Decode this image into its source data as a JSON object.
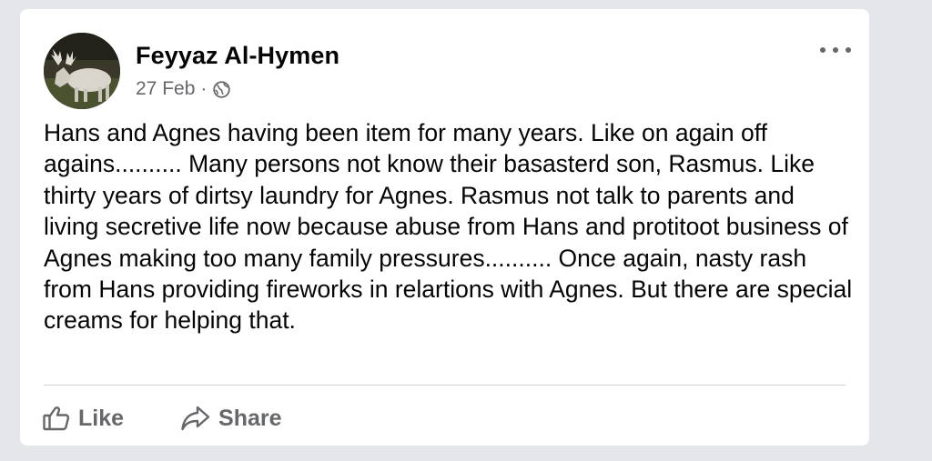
{
  "post": {
    "author_name": "Feyyaz Al-Hymen",
    "date": "27 Feb",
    "separator": "·",
    "privacy_icon": "globe-icon",
    "more_icon": "more-options-icon",
    "text": "Hans and Agnes having been item for many years. Like on again off agains.......... Many persons not know their basasterd son, Rasmus. Like thirty years of dirtsy laundry for Agnes. Rasmus not talk to parents  and living secretive life now because abuse from Hans and protitoot business of Agnes making too many family pressures.......... Once again, nasty rash from Hans providing fireworks in relartions with Agnes. But there are special creams for helping that."
  },
  "actions": {
    "like_label": "Like",
    "like_icon": "thumbs-up-icon",
    "share_label": "Share",
    "share_icon": "share-arrow-icon"
  },
  "colors": {
    "background": "#e4e6ea",
    "card": "#ffffff",
    "text_primary": "#050505",
    "text_secondary": "#65676b",
    "divider": "#ced0d4"
  }
}
